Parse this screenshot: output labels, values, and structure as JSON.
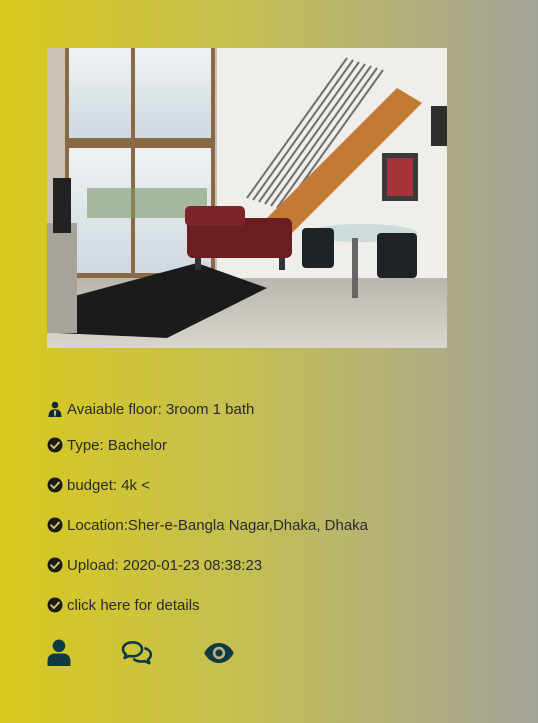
{
  "listing": {
    "photo_alt": "Loft apartment interior",
    "details": [
      {
        "icon": "user-tie-icon",
        "text": "Avaiable floor: 3room 1 bath"
      },
      {
        "icon": "check-circle-icon",
        "text": "Type: Bachelor"
      },
      {
        "icon": "check-circle-icon",
        "text": "budget: 4k <"
      },
      {
        "icon": "check-circle-icon",
        "text": "Location:Sher-e-Bangla Nagar,Dhaka, Dhaka"
      },
      {
        "icon": "check-circle-icon",
        "text": "Upload: 2020-01-23 08:38:23"
      },
      {
        "icon": "check-circle-icon",
        "text": "click here for details"
      }
    ],
    "actions": [
      {
        "icon": "user-icon"
      },
      {
        "icon": "comments-icon"
      },
      {
        "icon": "eye-icon"
      }
    ]
  },
  "colors": {
    "icon": "#0f2a33",
    "text": "#2b2b2b",
    "gradient_start": "#d9c91e",
    "gradient_end": "#a3a39b"
  }
}
